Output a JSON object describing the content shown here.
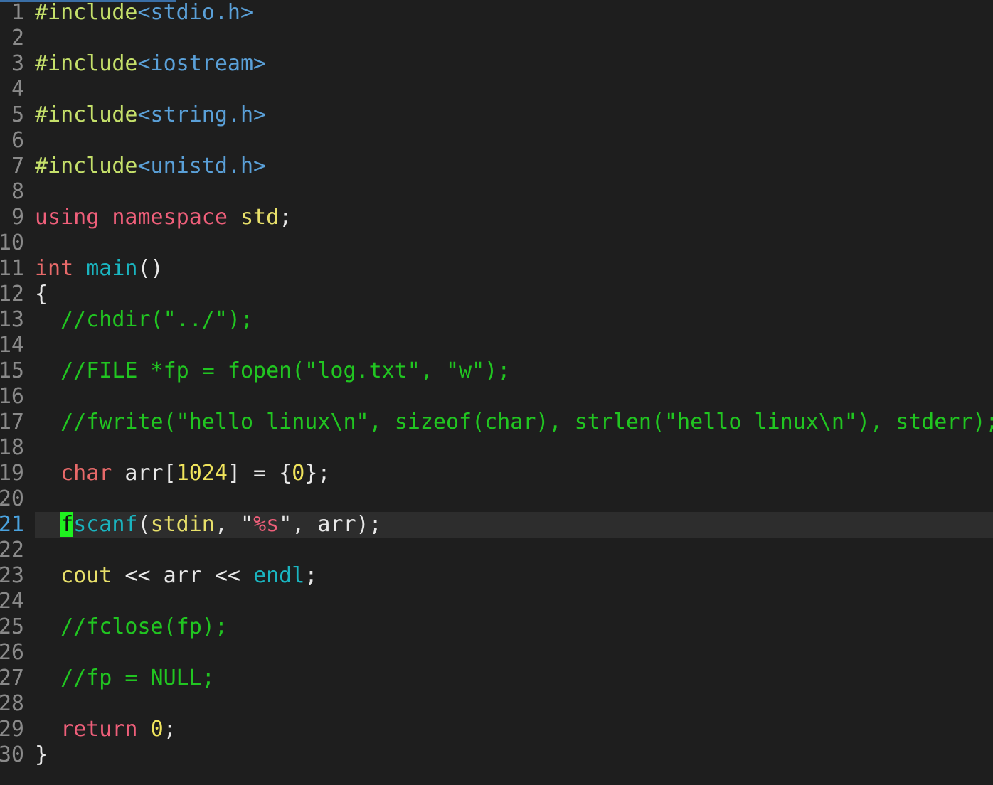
{
  "editor": {
    "current_line": 21,
    "lines": [
      {
        "no": "1",
        "tokens": [
          {
            "t": "#include",
            "c": "pre"
          },
          {
            "t": "<stdio.h>",
            "c": "inc"
          }
        ]
      },
      {
        "no": "2",
        "tokens": []
      },
      {
        "no": "3",
        "tokens": [
          {
            "t": "#include",
            "c": "pre"
          },
          {
            "t": "<iostream>",
            "c": "inc"
          }
        ]
      },
      {
        "no": "4",
        "tokens": []
      },
      {
        "no": "5",
        "tokens": [
          {
            "t": "#include",
            "c": "pre"
          },
          {
            "t": "<string.h>",
            "c": "inc"
          }
        ]
      },
      {
        "no": "6",
        "tokens": []
      },
      {
        "no": "7",
        "tokens": [
          {
            "t": "#include",
            "c": "pre"
          },
          {
            "t": "<unistd.h>",
            "c": "inc"
          }
        ]
      },
      {
        "no": "8",
        "tokens": []
      },
      {
        "no": "9",
        "tokens": [
          {
            "t": "using",
            "c": "kw"
          },
          {
            "t": " ",
            "c": "plain"
          },
          {
            "t": "namespace",
            "c": "kw"
          },
          {
            "t": " ",
            "c": "plain"
          },
          {
            "t": "std",
            "c": "id"
          },
          {
            "t": ";",
            "c": "plain"
          }
        ]
      },
      {
        "no": "10",
        "tokens": []
      },
      {
        "no": "11",
        "tokens": [
          {
            "t": "int",
            "c": "type"
          },
          {
            "t": " ",
            "c": "plain"
          },
          {
            "t": "main",
            "c": "fn"
          },
          {
            "t": "()",
            "c": "plain"
          }
        ]
      },
      {
        "no": "12",
        "tokens": [
          {
            "t": "{",
            "c": "plain"
          }
        ]
      },
      {
        "no": "13",
        "tokens": [
          {
            "t": "  //chdir(\"../\");",
            "c": "com"
          }
        ]
      },
      {
        "no": "14",
        "tokens": []
      },
      {
        "no": "15",
        "tokens": [
          {
            "t": "  //FILE *fp = fopen(\"log.txt\", \"w\");",
            "c": "com"
          }
        ]
      },
      {
        "no": "16",
        "tokens": []
      },
      {
        "no": "17",
        "tokens": [
          {
            "t": "  //fwrite(\"hello linux\\n\", sizeof(char), strlen(\"hello linux\\n\"), stderr);",
            "c": "com"
          }
        ]
      },
      {
        "no": "18",
        "tokens": []
      },
      {
        "no": "19",
        "tokens": [
          {
            "t": "  ",
            "c": "plain"
          },
          {
            "t": "char",
            "c": "type"
          },
          {
            "t": " arr[",
            "c": "plain"
          },
          {
            "t": "1024",
            "c": "num"
          },
          {
            "t": "] = {",
            "c": "plain"
          },
          {
            "t": "0",
            "c": "num"
          },
          {
            "t": "};",
            "c": "plain"
          }
        ]
      },
      {
        "no": "20",
        "tokens": []
      },
      {
        "no": "21",
        "tokens": [
          {
            "t": "  ",
            "c": "plain"
          },
          {
            "t": "f",
            "c": "cursor"
          },
          {
            "t": "scanf",
            "c": "fn"
          },
          {
            "t": "(",
            "c": "plain"
          },
          {
            "t": "stdin",
            "c": "id"
          },
          {
            "t": ", \"",
            "c": "plain"
          },
          {
            "t": "%s",
            "c": "fmt"
          },
          {
            "t": "\", arr);",
            "c": "plain"
          }
        ]
      },
      {
        "no": "22",
        "tokens": []
      },
      {
        "no": "23",
        "tokens": [
          {
            "t": "  ",
            "c": "plain"
          },
          {
            "t": "cout",
            "c": "id"
          },
          {
            "t": " << arr << ",
            "c": "plain"
          },
          {
            "t": "endl",
            "c": "fn"
          },
          {
            "t": ";",
            "c": "plain"
          }
        ]
      },
      {
        "no": "24",
        "tokens": []
      },
      {
        "no": "25",
        "tokens": [
          {
            "t": "  //fclose(fp);",
            "c": "com"
          }
        ]
      },
      {
        "no": "26",
        "tokens": []
      },
      {
        "no": "27",
        "tokens": [
          {
            "t": "  //fp = NULL;",
            "c": "com"
          }
        ]
      },
      {
        "no": "28",
        "tokens": []
      },
      {
        "no": "29",
        "tokens": [
          {
            "t": "  ",
            "c": "plain"
          },
          {
            "t": "return",
            "c": "kw"
          },
          {
            "t": " ",
            "c": "plain"
          },
          {
            "t": "0",
            "c": "num"
          },
          {
            "t": ";",
            "c": "plain"
          }
        ]
      },
      {
        "no": "30",
        "tokens": [
          {
            "t": "}",
            "c": "plain"
          }
        ]
      }
    ]
  },
  "colors": {
    "background": "#1e1e1e",
    "current_line_highlight": "#2d2d2d",
    "cursor": "#1ff01f",
    "preprocessor": "#c5e06a",
    "include_path": "#5aa0d8",
    "keyword": "#ef5f7a",
    "function": "#1ab5c0",
    "comment": "#21c521",
    "number": "#f0e45c"
  }
}
